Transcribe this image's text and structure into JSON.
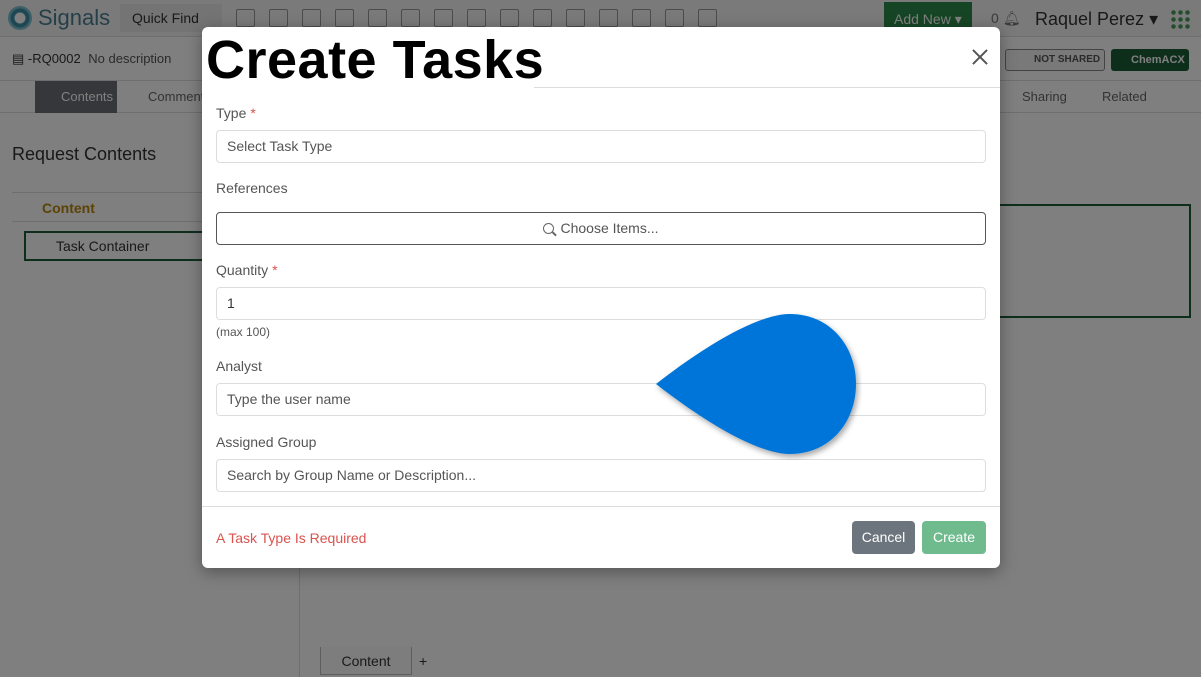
{
  "app": {
    "logo_text": "Signals",
    "quick_find": "Quick Find",
    "add_new": "Add New",
    "notification_count": "0",
    "user_name": "Raquel Perez"
  },
  "request": {
    "id": "-RQ0002",
    "description": "No description",
    "share_status": "NOT SHARED",
    "chemacx": "ChemACX"
  },
  "tabs": {
    "contents": "Contents",
    "comments": "Comment",
    "sharing": "Sharing",
    "related": "Related"
  },
  "left_panel": {
    "title": "Request Contents",
    "section": "Content",
    "item": "Task Container"
  },
  "bottom_tab": "Content",
  "modal": {
    "title": "Create Tasks",
    "type_label": "Type",
    "type_placeholder": "Select Task Type",
    "references_label": "References",
    "choose_items": "Choose Items...",
    "quantity_label": "Quantity",
    "quantity_value": "1",
    "quantity_hint": "(max 100)",
    "analyst_label": "Analyst",
    "analyst_placeholder": "Type the user name",
    "group_label": "Assigned Group",
    "group_placeholder": "Search by Group Name or Description...",
    "error": "A Task Type Is Required",
    "cancel": "Cancel",
    "create": "Create",
    "required_marker": "*"
  },
  "colors": {
    "accent_green": "#2c8a4b",
    "create_button": "#6fbb8e",
    "cancel_button": "#6c757d",
    "error_red": "#d9534f",
    "marker_blue": "#0074d9"
  }
}
